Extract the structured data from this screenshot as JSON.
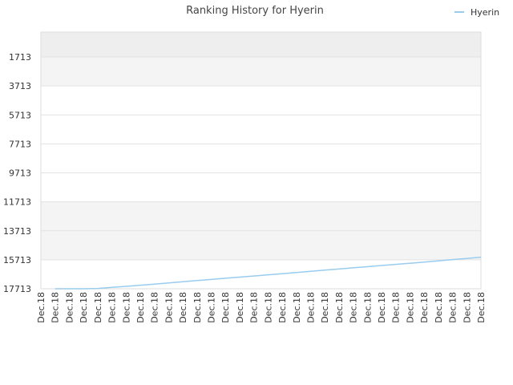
{
  "chart_data": {
    "type": "line",
    "title": "Ranking History for Hyerin",
    "xlabel": "",
    "ylabel": "",
    "y_inverted": true,
    "ylim": [
      17713,
      1713
    ],
    "yticks": [
      1713,
      3713,
      5713,
      7713,
      9713,
      11713,
      13713,
      15713,
      17713
    ],
    "x": [
      "Dec.18",
      "Dec.18",
      "Dec.18",
      "Dec.18",
      "Dec.18",
      "Dec.18",
      "Dec.18",
      "Dec.18",
      "Dec.18",
      "Dec.18",
      "Dec.18",
      "Dec.18",
      "Dec.18",
      "Dec.18",
      "Dec.18",
      "Dec.18",
      "Dec.18",
      "Dec.18",
      "Dec.18",
      "Dec.18",
      "Dec.18",
      "Dec.18",
      "Dec.18",
      "Dec.18",
      "Dec.18",
      "Dec.18",
      "Dec.18",
      "Dec.18",
      "Dec.18",
      "Dec.18",
      "Dec.18",
      "Dec.18"
    ],
    "grid": true,
    "legend_position": "top-right",
    "series": [
      {
        "name": "Hyerin",
        "color": "#99ccee",
        "values": [
          null,
          17713,
          17713,
          17713,
          17690,
          17620,
          17545,
          17470,
          17390,
          17310,
          17230,
          17150,
          17070,
          16990,
          16910,
          16830,
          16750,
          16670,
          16590,
          16510,
          16430,
          16350,
          16270,
          16190,
          16110,
          16030,
          15950,
          15870,
          15790,
          15700,
          15620,
          15530
        ]
      }
    ],
    "band_colors": [
      "#eeeeee",
      "#f4f4f4",
      "#ffffff"
    ]
  }
}
